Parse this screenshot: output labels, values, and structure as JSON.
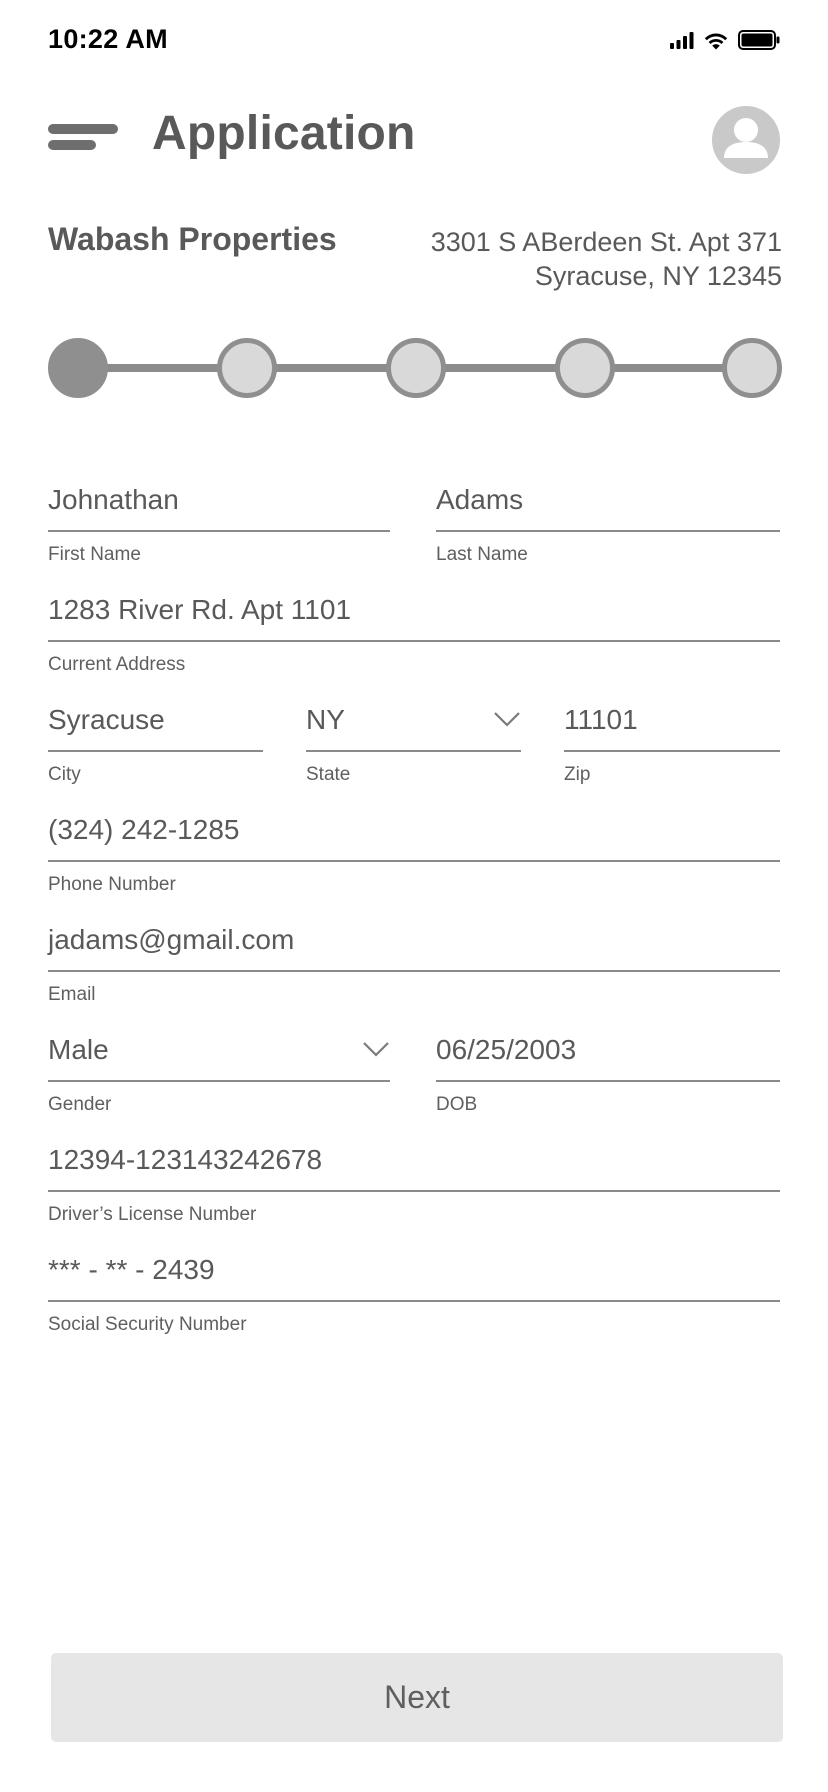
{
  "status_bar": {
    "time": "10:22 AM",
    "icons": [
      "signal-icon",
      "wifi-icon",
      "battery-icon"
    ]
  },
  "header": {
    "title": "Application",
    "menu_icon": "hamburger-menu-icon",
    "avatar_icon": "user-avatar-icon"
  },
  "property": {
    "name": "Wabash Properties",
    "address_line1": "3301 S ABerdeen St. Apt 371",
    "address_line2": "Syracuse, NY 12345"
  },
  "stepper": {
    "total_steps": 5,
    "current_step": 1
  },
  "form": {
    "first_name": {
      "value": "Johnathan",
      "label": "First Name"
    },
    "last_name": {
      "value": "Adams",
      "label": "Last Name"
    },
    "current_address": {
      "value": "1283 River Rd. Apt 1101",
      "label": "Current Address"
    },
    "city": {
      "value": "Syracuse",
      "label": "City"
    },
    "state": {
      "value": "NY",
      "label": "State"
    },
    "zip": {
      "value": "11101",
      "label": "Zip"
    },
    "phone": {
      "value": "(324) 242-1285",
      "label": "Phone Number"
    },
    "email": {
      "value": "jadams@gmail.com",
      "label": "Email"
    },
    "gender": {
      "value": "Male",
      "label": "Gender"
    },
    "dob": {
      "value": "06/25/2003",
      "label": "DOB"
    },
    "license": {
      "value": "12394-123143242678",
      "label": "Driver’s License Number"
    },
    "ssn": {
      "value": "*** - ** - 2439",
      "label": "Social Security Number"
    }
  },
  "actions": {
    "next_label": "Next"
  },
  "colors": {
    "text": "#595959",
    "step_active": "#8f8f8f",
    "step_inactive": "#d9d9d9",
    "button_bg": "#e6e6e6"
  }
}
